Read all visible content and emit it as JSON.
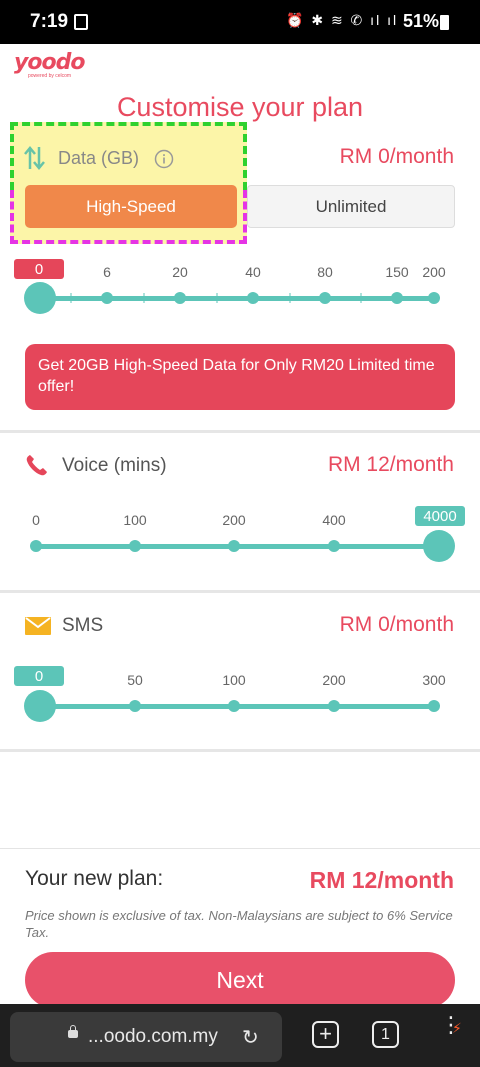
{
  "status_bar": {
    "time": "7:19",
    "battery": "51%"
  },
  "brand": {
    "logo_text": "yoodo",
    "logo_sub": "powered by celcom"
  },
  "title": "Customise your plan",
  "data": {
    "label": "Data (GB)",
    "price": "RM 0/month",
    "toggle": {
      "left": "High-Speed",
      "right": "Unlimited",
      "selected": "High-Speed"
    },
    "current_value": "0",
    "ticks": [
      "0",
      "6",
      "20",
      "40",
      "80",
      "150",
      "200"
    ],
    "promo": "Get 20GB High-Speed Data for Only RM20 Limited time offer!"
  },
  "voice": {
    "label": "Voice (mins)",
    "price": "RM 12/month",
    "ticks": [
      "0",
      "100",
      "200",
      "400",
      "4000"
    ],
    "current_value": "4000"
  },
  "sms": {
    "label": "SMS",
    "price": "RM 0/month",
    "current_value": "0",
    "ticks": [
      "0",
      "50",
      "100",
      "200",
      "300"
    ]
  },
  "summary": {
    "label": "Your new plan:",
    "price": "RM 12/month",
    "note": "Price shown is exclusive of tax. Non-Malaysians are subject to 6% Service Tax.",
    "next": "Next"
  },
  "browser": {
    "url": "...oodo.com.my",
    "tab_count": "1"
  },
  "colors": {
    "accent": "#e84a5f",
    "teal": "#5cc5b8",
    "orange": "#f0884a"
  }
}
